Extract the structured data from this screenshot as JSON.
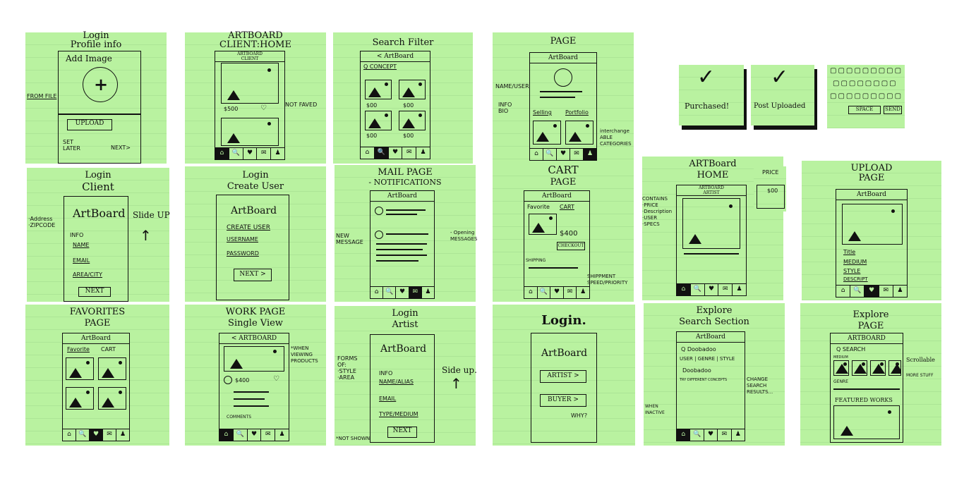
{
  "nav_icons": [
    "⌂",
    "🔍",
    "♥",
    "✉",
    "♟"
  ],
  "n1": {
    "title1": "Login",
    "title2": "Profile info",
    "add_image": "Add Image",
    "from_file": "FROM FILE",
    "upload": "UPLOAD",
    "set_later": "SET\nLATER",
    "next": "NEXT>"
  },
  "n2": {
    "title1": "ARTBOARD",
    "title2": "CLIENT:HOME",
    "header": "ARTBOARD\nCLIENT",
    "price": "$500",
    "not_faved": "NOT FAVED"
  },
  "n3": {
    "title1": "Search Filter",
    "header": "< ArtBoard",
    "search": "Q CONCEPT",
    "p1": "$00",
    "p2": "$00",
    "p3": "$00",
    "p4": "$00"
  },
  "n4": {
    "title1": "PAGE",
    "header": "ArtBoard",
    "name_user": "NAME/USER",
    "info_bio": "INFO\nBIO",
    "selling": "Selling",
    "portfolio": "Portfolio",
    "interchange": "interchange\nABLE\nCATEGORIES"
  },
  "n5": {
    "check1": "Purchased!",
    "check2": "Post Uploaded",
    "space": "SPACE",
    "send": "SEND"
  },
  "n6": {
    "title1": "Login",
    "title2": "Client",
    "address": "·Address\n·ZIPCODE",
    "logo": "ArtBoard",
    "info": "INFO",
    "name": "NAME",
    "email": "EMAIL",
    "area": "AREA/CITY",
    "next": "NEXT",
    "slide": "Slide UP"
  },
  "n7": {
    "title1": "Login",
    "title2": "Create User",
    "logo": "ArtBoard",
    "create": "CREATE USER",
    "username": "USERNAME",
    "password": "PASSWORD",
    "next": "NEXT >"
  },
  "n8": {
    "title1": "MAIL PAGE",
    "title2": "- NOTIFICATIONS",
    "header": "ArtBoard",
    "new_msg": "NEW\nMESSAGE",
    "opening": "- Opening\nMESSAGES"
  },
  "n9": {
    "title1": "CART",
    "title2": "PAGE",
    "header": "ArtBoard",
    "favorite": "Favorite",
    "cart": "CART",
    "price": "$400",
    "checkout": "CHECKOUT",
    "shipping": "SHIPPING",
    "speed": "SHIPPMENT\nSPEED/PRIORITY"
  },
  "n10": {
    "title1": "ARTBoard",
    "title2": "HOME",
    "header": "ARTBOARD\nARTIST",
    "price_label": "PRICE",
    "price": "$00",
    "contains": "CONTAINS\n·PRICE\n·Description\n·USER\n·SPECS"
  },
  "n11": {
    "title1": "UPLOAD",
    "title2": "PAGE",
    "header": "ArtBoard",
    "title_f": "Title",
    "medium": "MEDIUM",
    "style": "STYLE",
    "descript": "DESCRIPT"
  },
  "n12": {
    "title1": "FAVORITES",
    "title2": "PAGE",
    "header": "ArtBoard",
    "favorite": "Favorite",
    "cart": "CART"
  },
  "n13": {
    "title1": "WORK PAGE",
    "title2": "Single View",
    "header": "< ARTBOARD",
    "price": "$400",
    "comments": "COMMENTS",
    "note": "*WHEN\nVIEWING\nPRODUCTS"
  },
  "n14": {
    "title1": "Login",
    "title2": "Artist",
    "logo": "ArtBoard",
    "info": "INFO",
    "name": "NAME/ALIAS",
    "email": "EMAIL",
    "type": "TYPE/MEDIUM",
    "next": "NEXT",
    "forms": "FORMS\nOF:\n·STYLE\n·AREA",
    "slide": "Side up.",
    "not_shown": "*NOT SHOWN"
  },
  "n15": {
    "title1": "Login.",
    "logo": "ArtBoard",
    "artist": "ARTIST >",
    "buyer": "BUYER >",
    "why": "WHY?"
  },
  "n16": {
    "title1": "Explore",
    "title2": "Search Section",
    "header": "ArtBoard",
    "search": "Q Doobadoo",
    "tabs": "USER | GENRE | STYLE",
    "result": "Doobadoo",
    "caption": "TRY DIFFERENT CONCEPTS",
    "change": "CHANGE\nSEARCH\nRESULTS...",
    "inactive": "WHEN\nINACTIVE"
  },
  "n17": {
    "title1": "Explore",
    "title2": "PAGE",
    "header": "ARTBOARD",
    "search": "Q SEARCH",
    "medium": "MEDIUM",
    "genre": "GENRE",
    "featured": "FEATURED WORKS",
    "scroll": "Scrollable",
    "more": "MORE STUFF"
  }
}
